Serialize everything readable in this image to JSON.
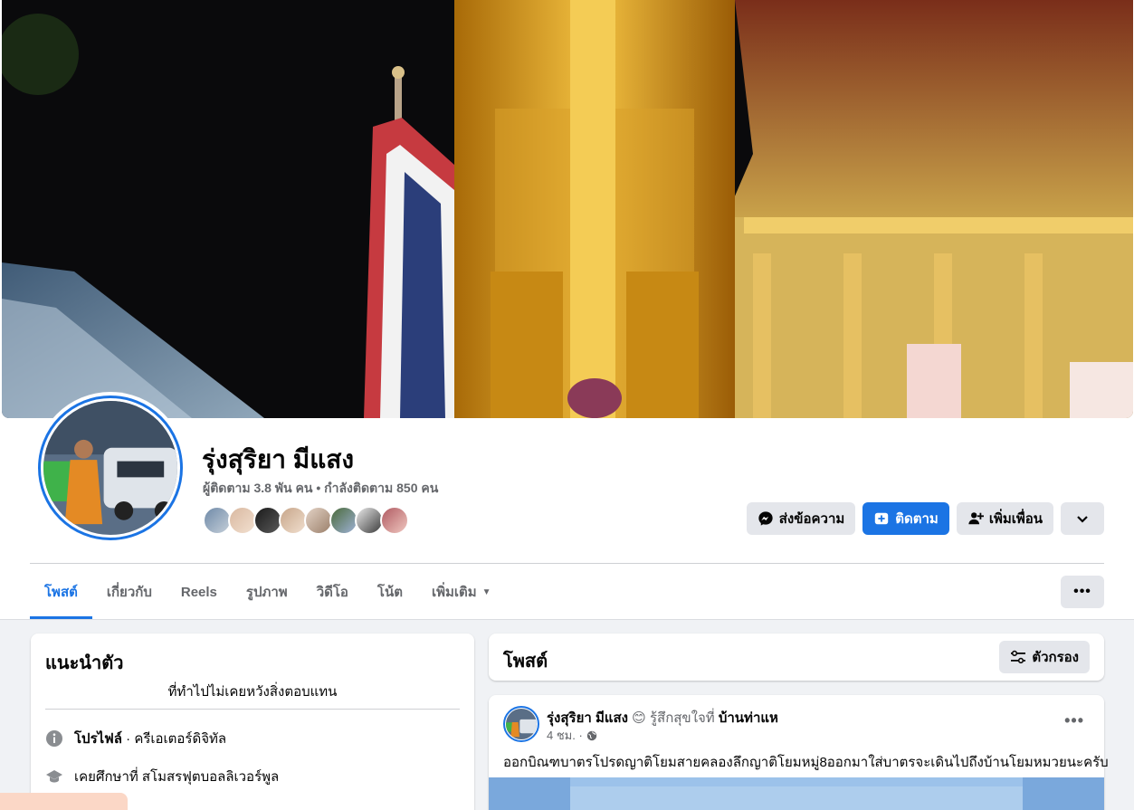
{
  "profile": {
    "name": "รุ่งสุริยา มีแสง",
    "stats": "ผู้ติดตาม 3.8 พัน คน • กำลังติดตาม 850 คน"
  },
  "actions": {
    "message": "ส่งข้อความ",
    "follow": "ติดตาม",
    "add_friend": "เพิ่มเพื่อน"
  },
  "tabs": [
    {
      "label": "โพสต์",
      "active": true
    },
    {
      "label": "เกี่ยวกับ"
    },
    {
      "label": "Reels"
    },
    {
      "label": "รูปภาพ"
    },
    {
      "label": "วิดีโอ"
    },
    {
      "label": "โน้ต"
    },
    {
      "label": "เพิ่มเติม"
    }
  ],
  "intro": {
    "title": "แนะนำตัว",
    "bio": "ที่ทำไปไม่เคยหวังสิ่งตอบแทน",
    "profile_label": "โปรไฟล์",
    "profile_value": " · ครีเอเตอร์ดิจิทัล",
    "education": "เคยศึกษาที่ สโมสรฟุตบอลลิเวอร์พูล"
  },
  "posts": {
    "title": "โพสต์",
    "filter_label": "ตัวกรอง"
  },
  "post": {
    "author": "รุ่งสุริยา มีแสง",
    "feeling": " 😊 รู้สึกสุขใจที่ ",
    "place": "บ้านท่าแห",
    "time": "4 ชม. ·",
    "text": "ออกบิณฑบาตรโปรดญาติโยมสายคลองลึกญาติโยมหมู่8ออกมาใส่บาตรจะเดินไปถึงบ้านโยมหมวยนะครับ"
  },
  "colors": {
    "accent": "#1b74e4",
    "page_bg": "#f0f2f5",
    "button_gray": "#e4e6eb"
  }
}
